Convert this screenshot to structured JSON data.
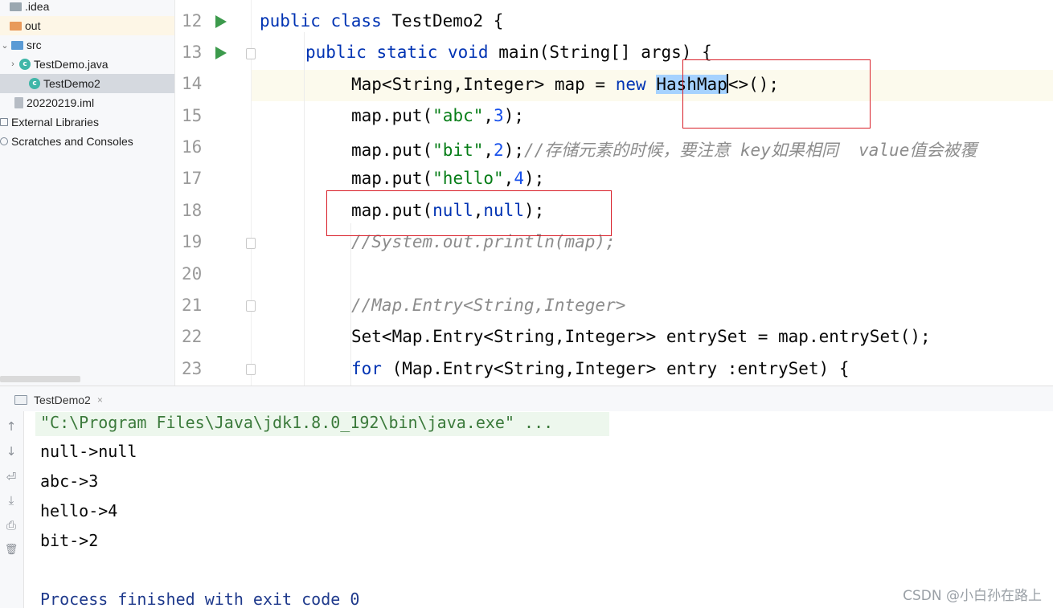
{
  "sidebar": {
    "items": [
      {
        "label": ".idea",
        "indent": 1,
        "icon": "folder-grey-icon"
      },
      {
        "label": "out",
        "indent": 1,
        "icon": "folder-orange-icon"
      },
      {
        "label": "src",
        "indent": 1,
        "icon": "folder-blue-icon"
      },
      {
        "label": "TestDemo.java",
        "indent": 2,
        "icon": "java-class-icon"
      },
      {
        "label": "TestDemo2",
        "indent": 2,
        "icon": "java-class-icon"
      },
      {
        "label": "20220219.iml",
        "indent": 1,
        "icon": "module-file-icon"
      },
      {
        "label": "External Libraries",
        "indent": 0,
        "icon": "library-icon"
      },
      {
        "label": "Scratches and Consoles",
        "indent": 0,
        "icon": "scratch-icon"
      }
    ]
  },
  "editor": {
    "line_numbers": [
      "12",
      "13",
      "14",
      "15",
      "16",
      "17",
      "18",
      "19",
      "20",
      "21",
      "22",
      "23"
    ],
    "lines": {
      "l12_kw": "public class ",
      "l12_rest": "TestDemo2 {",
      "l13_kw": "public static void ",
      "l13_rest": "main(String[] args) {",
      "l14_a": "Map<String,Integer> map = ",
      "l14_kw": "new ",
      "l14_sel": "HashMap",
      "l14_rest": "<>();",
      "l15_a": "map.put(",
      "l15_str": "\"abc\"",
      "l15_c": ",",
      "l15_num": "3",
      "l15_e": ");",
      "l16_a": "map.put(",
      "l16_str": "\"bit\"",
      "l16_c": ",",
      "l16_num": "2",
      "l16_e": ");",
      "l16_cmt": "//存储元素的时候，要注意 key如果相同  value值会被覆",
      "l17_a": "map.put(",
      "l17_str": "\"hello\"",
      "l17_c": ",",
      "l17_num": "4",
      "l17_e": ");",
      "l18_a": "map.put(",
      "l18_kw1": "null",
      "l18_c": ",",
      "l18_kw2": "null",
      "l18_e": ");",
      "l19_cmt": "//System.out.println(map);",
      "l21_cmt": "//Map.Entry<String,Integer>",
      "l22": "Set<Map.Entry<String,Integer>> entrySet = map.entrySet();",
      "l23_kw": "for ",
      "l23_rest": "(Map.Entry<String,Integer> entry :entrySet) {"
    }
  },
  "run_panel": {
    "tab_label": "TestDemo2",
    "tab_close": "×",
    "toolbar": {
      "up": "↑",
      "down": "↓",
      "wrap": "⏎",
      "scroll_end": "⤓",
      "print": "⎙",
      "clear": "🗑"
    },
    "output": [
      "\"C:\\Program Files\\Java\\jdk1.8.0_192\\bin\\java.exe\" ...",
      "null->null",
      "abc->3",
      "hello->4",
      "bit->2",
      "",
      "Process finished with exit code 0"
    ]
  },
  "watermark": "CSDN @小白孙在路上",
  "colors": {
    "keyword": "#0033b3",
    "string": "#067d17",
    "number": "#1750eb",
    "comment": "#8c8c8c",
    "highlight_box": "#d81e28",
    "selection": "#a6d2ff"
  }
}
